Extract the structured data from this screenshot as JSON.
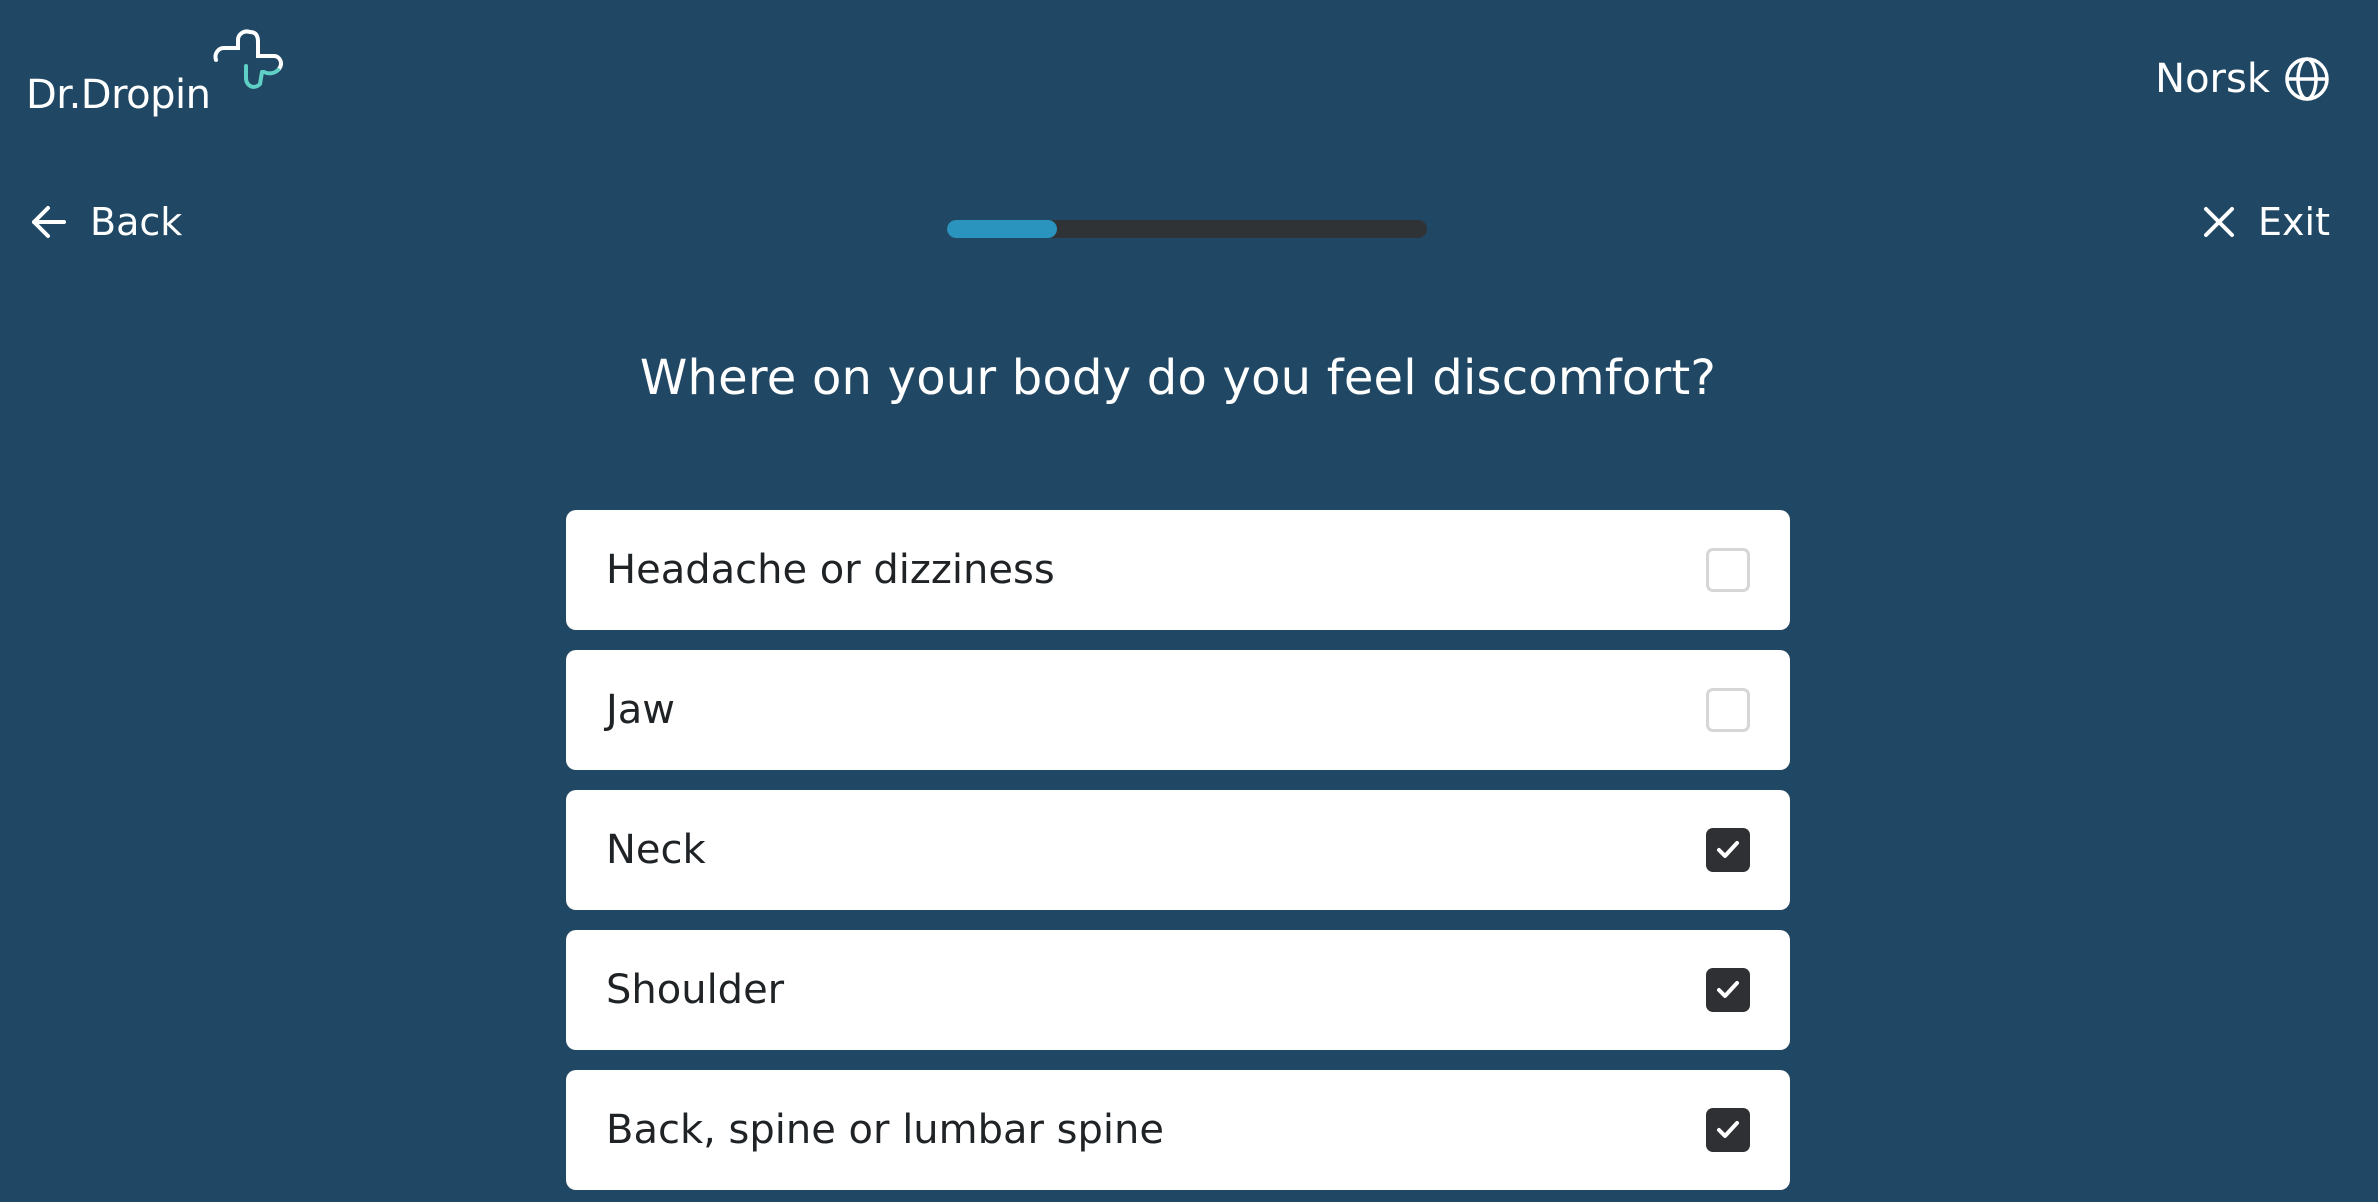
{
  "brand": {
    "name": "Dr.Dropin",
    "accent_color": "#5fd0c6"
  },
  "header": {
    "language_label": "Norsk",
    "language_icon": "globe-icon"
  },
  "nav": {
    "back_label": "Back",
    "back_icon": "arrow-left-icon",
    "exit_label": "Exit",
    "exit_icon": "close-icon"
  },
  "progress": {
    "fraction": 0.23,
    "fill_color": "#2a93be",
    "track_color": "#2f3336"
  },
  "question": {
    "text": "Where on your body do you feel discomfort?"
  },
  "options": [
    {
      "label": "Headache or dizziness",
      "checked": false
    },
    {
      "label": "Jaw",
      "checked": false
    },
    {
      "label": "Neck",
      "checked": true
    },
    {
      "label": "Shoulder",
      "checked": true
    },
    {
      "label": "Back, spine or lumbar spine",
      "checked": true
    }
  ],
  "colors": {
    "background": "#204864",
    "card": "#ffffff",
    "checked_box": "#2e3033"
  }
}
